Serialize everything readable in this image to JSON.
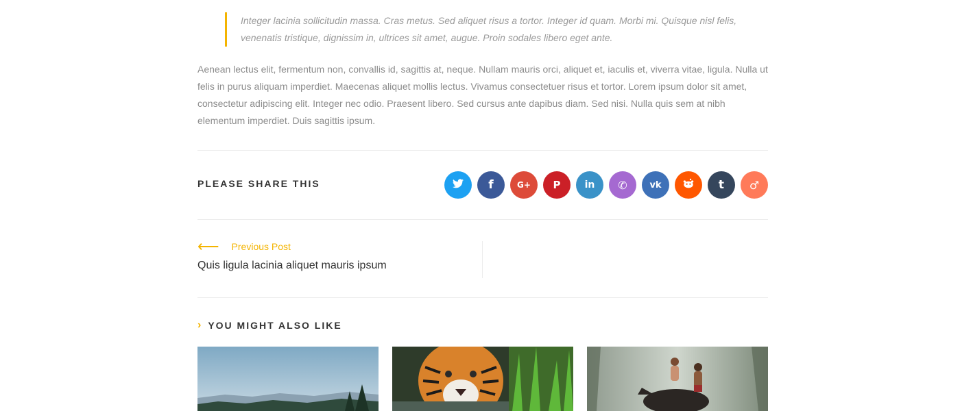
{
  "article": {
    "blockquote": "Integer lacinia sollicitudin massa. Cras metus. Sed aliquet risus a tortor. Integer id quam. Morbi mi. Quisque nisl felis, venenatis tristique, dignissim in, ultrices sit amet, augue. Proin sodales libero eget ante.",
    "paragraph": "Aenean lectus elit, fermentum non, convallis id, sagittis at, neque. Nullam mauris orci, aliquet et, iaculis et, viverra vitae, ligula. Nulla ut felis in purus aliquam imperdiet. Maecenas aliquet mollis lectus. Vivamus consectetuer risus et tortor. Lorem ipsum dolor sit amet, consectetur adipiscing elit. Integer nec odio. Praesent libero. Sed cursus ante dapibus diam. Sed nisi. Nulla quis sem at nibh elementum imperdiet. Duis sagittis ipsum."
  },
  "share": {
    "title": "PLEASE SHARE THIS",
    "buttons": [
      {
        "name": "twitter",
        "glyph": "t",
        "color": "#1da1f2"
      },
      {
        "name": "facebook",
        "glyph": "f",
        "color": "#3b5998"
      },
      {
        "name": "google-plus",
        "glyph": "G+",
        "color": "#dd4b39"
      },
      {
        "name": "pinterest",
        "glyph": "P",
        "color": "#cb2027"
      },
      {
        "name": "linkedin",
        "glyph": "in",
        "color": "#3a92c8"
      },
      {
        "name": "viber",
        "glyph": "✆",
        "color": "#a569d1"
      },
      {
        "name": "vk",
        "glyph": "vk",
        "color": "#3e71b8"
      },
      {
        "name": "reddit",
        "glyph": "◉",
        "color": "#ff5700"
      },
      {
        "name": "tumblr",
        "glyph": "t",
        "color": "#35465c"
      },
      {
        "name": "mix",
        "glyph": "♂",
        "color": "#ff7a59"
      }
    ]
  },
  "post_nav": {
    "prev_label": "Previous Post",
    "prev_title": "Quis ligula lacinia aliquet mauris ipsum"
  },
  "related": {
    "title": "YOU MIGHT ALSO LIKE"
  },
  "colors": {
    "accent": "#f4b400"
  }
}
